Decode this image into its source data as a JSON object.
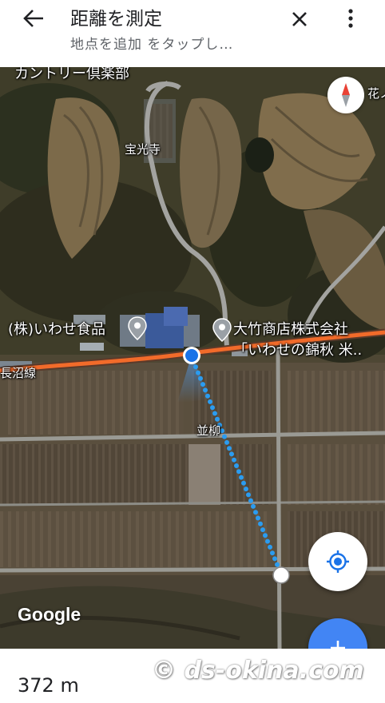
{
  "header": {
    "title": "距離を測定",
    "subtitle": "地点を追加 をタップし…",
    "back_icon": "arrow-back-icon",
    "close_icon": "close-icon",
    "menu_icon": "more-vert-icon"
  },
  "map": {
    "labels": {
      "country_club": "カントリー倶楽部",
      "edge_top_right": "花ノ",
      "temple": "宝光寺",
      "company_left": "(株)いわせ食品",
      "company_right_line1": "大竹商店株式会社",
      "company_right_line2": "「いわせの錦秋 米..",
      "railway": "長沼線",
      "area": "並柳"
    },
    "google_logo": "Google",
    "colors": {
      "route_line": "#f26b2a",
      "measure_dots": "#2b9cf0",
      "location_dot": "#1a73e8",
      "fab_blue": "#4285f4"
    }
  },
  "controls": {
    "compass_icon": "compass-icon",
    "my_location_icon": "my-location-icon",
    "add_point_icon": "plus-icon"
  },
  "bottom": {
    "distance": "372 m",
    "watermark": "© ds-okina.com"
  }
}
